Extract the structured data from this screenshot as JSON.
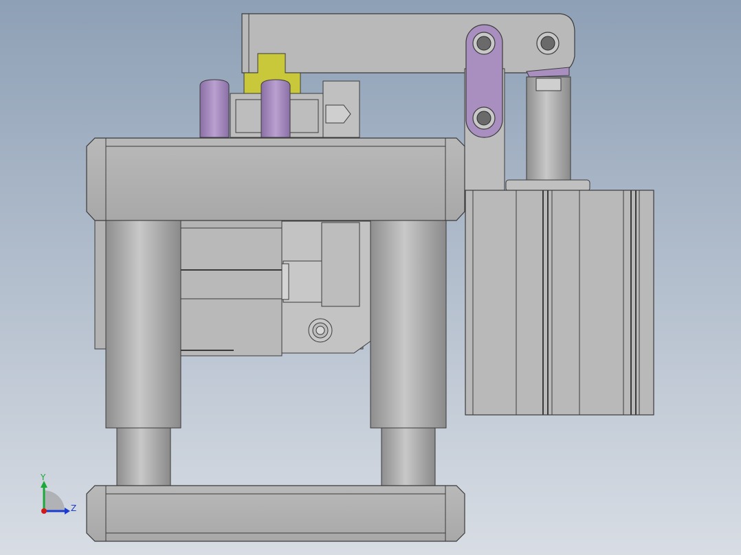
{
  "viewport": {
    "background_top": "#8ea0b6",
    "background_bottom": "#d8dde4"
  },
  "triad": {
    "y_label": "Y",
    "z_label": "Z",
    "y_color": "#1aa83a",
    "z_color": "#1a3ad0",
    "x_color": "#d01a1a"
  },
  "colors": {
    "steel": "#b4b4b4",
    "steel_dark": "#8a8a8a",
    "edge": "#3a3a3a",
    "purple": "#a98ec0",
    "yellow": "#c8c83a"
  }
}
